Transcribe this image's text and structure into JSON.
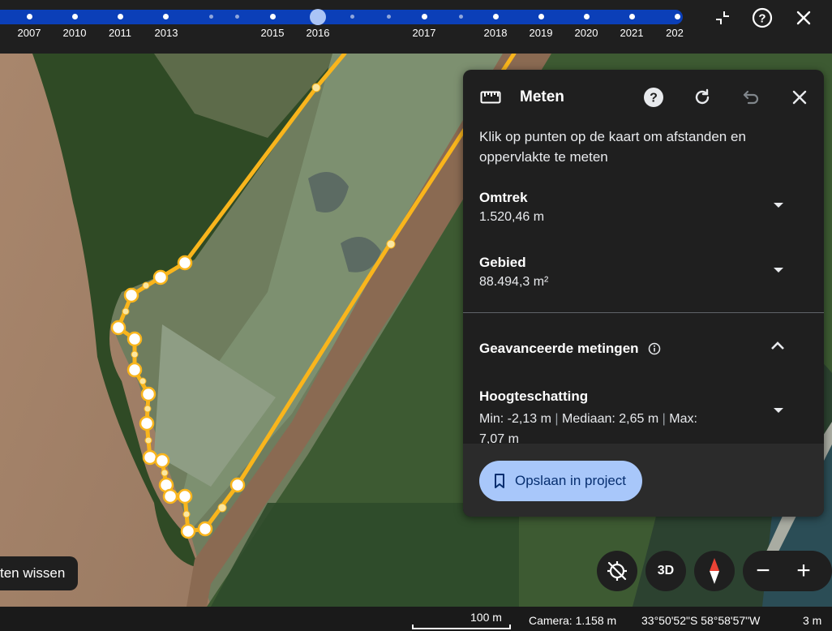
{
  "timeline": {
    "years": [
      "2007",
      "2010",
      "2011",
      "2013",
      "2015",
      "2016",
      "2017",
      "2018",
      "2019",
      "2020",
      "2021",
      "202"
    ],
    "current_year": "2016",
    "collapse_icon": "collapse-icon",
    "help_icon": "help-icon",
    "close_icon": "close-icon"
  },
  "panel": {
    "title": "Meten",
    "description": "Klik op punten op de kaart om afstanden en oppervlakte te meten",
    "perimeter": {
      "label": "Omtrek",
      "value": "1.520,46 m"
    },
    "area": {
      "label": "Gebied",
      "value": "88.494,3 m²"
    },
    "advanced": {
      "label": "Geavanceerde metingen"
    },
    "height": {
      "label": "Hoogteschatting",
      "min": "Min: -2,13 m",
      "median": "Mediaan: 2,65 m",
      "max": "Max: 7,07 m",
      "separator": "|"
    },
    "save_label": "Opslaan in project",
    "accent": "#a8c7fa"
  },
  "map_controls": {
    "three_d": "3D",
    "zoom_out": "−",
    "zoom_in": "+"
  },
  "clear_button": "ten wissen",
  "status": {
    "scale": "100 m",
    "camera": "Camera: 1.158 m",
    "coords": "33°50'52\"S 58°58'57\"W",
    "elevation": "3 m"
  },
  "colors": {
    "measure_line": "#f9b51c",
    "timeline_track": "#0b3fb8"
  }
}
